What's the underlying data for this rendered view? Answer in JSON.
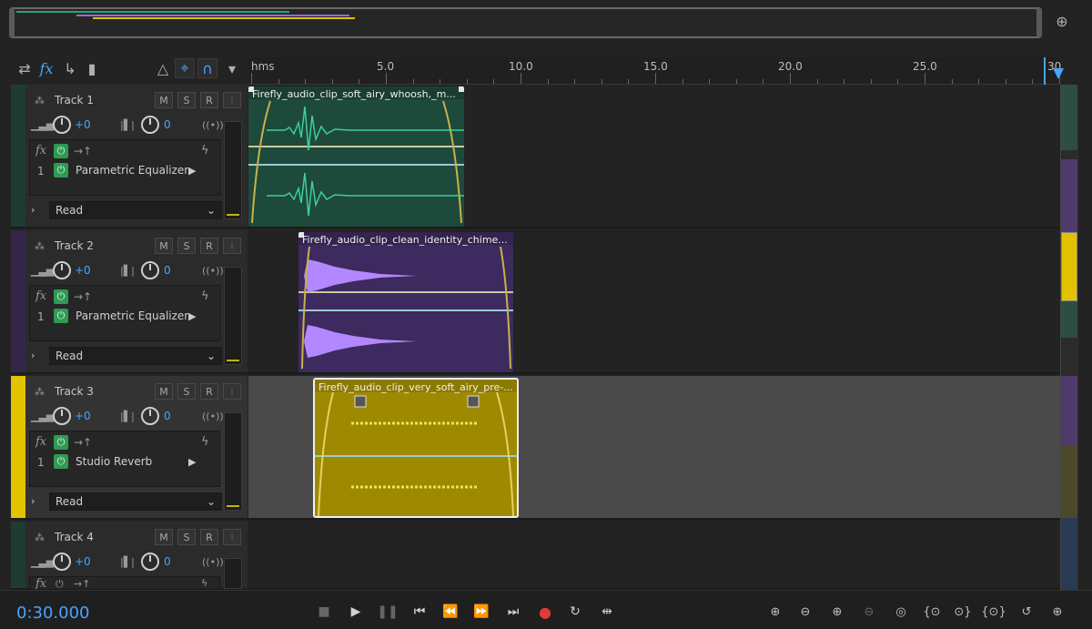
{
  "colors": {
    "track1": "#1f6e55",
    "track2": "#5b3b8c",
    "track3": "#e3c200",
    "track4": "#1f6e55",
    "accent": "#4aa3ff",
    "record": "#e03a3a"
  },
  "ruler": {
    "labels": [
      "hms",
      "5.0",
      "10.0",
      "15.0",
      "20.0",
      "25.0",
      "30"
    ]
  },
  "tracks": [
    {
      "name": "Track 1",
      "mute": "M",
      "solo": "S",
      "record": "R",
      "volume": "+0",
      "pan": "0",
      "fx_label": "fx",
      "slot_number": "1",
      "effect": "Parametric Equalizer",
      "automation": "Read",
      "clip_title": "Firefly_audio_clip_soft_airy_whoosh,_m..."
    },
    {
      "name": "Track 2",
      "mute": "M",
      "solo": "S",
      "record": "R",
      "volume": "+0",
      "pan": "0",
      "fx_label": "fx",
      "slot_number": "1",
      "effect": "Parametric Equalizer",
      "automation": "Read",
      "clip_title": "Firefly_audio_clip_clean_identity_chime..."
    },
    {
      "name": "Track 3",
      "mute": "M",
      "solo": "S",
      "record": "R",
      "volume": "+0",
      "pan": "0",
      "fx_label": "fx",
      "slot_number": "1",
      "effect": "Studio Reverb",
      "automation": "Read",
      "clip_title": "Firefly_audio_clip_very_soft_airy_pre-..."
    },
    {
      "name": "Track 4",
      "mute": "M",
      "solo": "S",
      "record": "R",
      "volume": "+0",
      "pan": "0",
      "fx_label": "fx"
    }
  ],
  "transport": {
    "timecode": "0:30.000"
  },
  "icons": {
    "toolbar": [
      "swap-icon",
      "fx-icon",
      "send-icon",
      "bars-icon",
      "metronome-icon",
      "snap-icon",
      "magnet-icon",
      "marker-icon"
    ],
    "transport": [
      "stop-icon",
      "play-icon",
      "pause-icon",
      "skip-back-icon",
      "rewind-icon",
      "fast-forward-icon",
      "skip-forward-icon",
      "record-icon",
      "loop-icon",
      "skip-selection-icon"
    ],
    "zoom": [
      "zoom-in-amplitude-icon",
      "zoom-out-amplitude-icon",
      "zoom-in-time-icon",
      "zoom-out-time-icon",
      "zoom-full-icon",
      "zoom-in-left-icon",
      "zoom-in-right-icon",
      "zoom-selection-icon",
      "zoom-reset-icon",
      "zoom-tracks-icon"
    ]
  }
}
